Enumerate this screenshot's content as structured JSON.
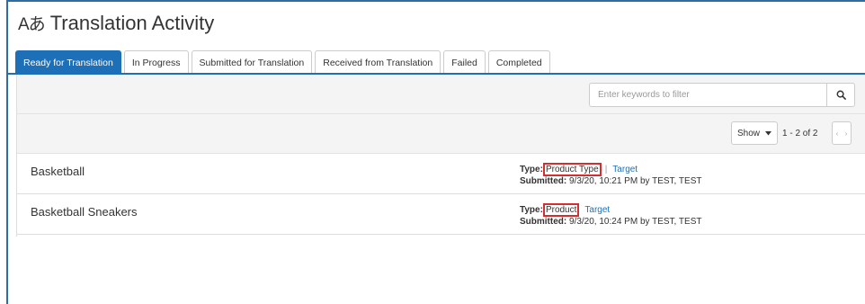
{
  "header": {
    "icon": "translate-icon",
    "glyph": "Aあ",
    "title": "Translation Activity"
  },
  "tabs": [
    {
      "label": "Ready for Translation",
      "active": true
    },
    {
      "label": "In Progress"
    },
    {
      "label": "Submitted for Translation"
    },
    {
      "label": "Received from Translation"
    },
    {
      "label": "Failed"
    },
    {
      "label": "Completed"
    }
  ],
  "filter": {
    "placeholder": "Enter keywords to filter",
    "search_icon": "search-icon"
  },
  "pagination": {
    "show_label": "Show",
    "range": "1 - 2 of 2"
  },
  "rows": [
    {
      "name": "Basketball",
      "type_label": "Type:",
      "type_value": "Product Type",
      "separator": "|",
      "target_link": "Target",
      "submitted_label": "Submitted:",
      "submitted_value": "9/3/20, 10:21 PM by TEST, TEST"
    },
    {
      "name": "Basketball Sneakers",
      "type_label": "Type:",
      "type_value": "Product",
      "target_link": "Target",
      "submitted_label": "Submitted:",
      "submitted_value": "9/3/20, 10:24 PM by TEST, TEST"
    }
  ],
  "colors": {
    "accent": "#1d6fb8",
    "highlight_box": "#d32f2f"
  }
}
